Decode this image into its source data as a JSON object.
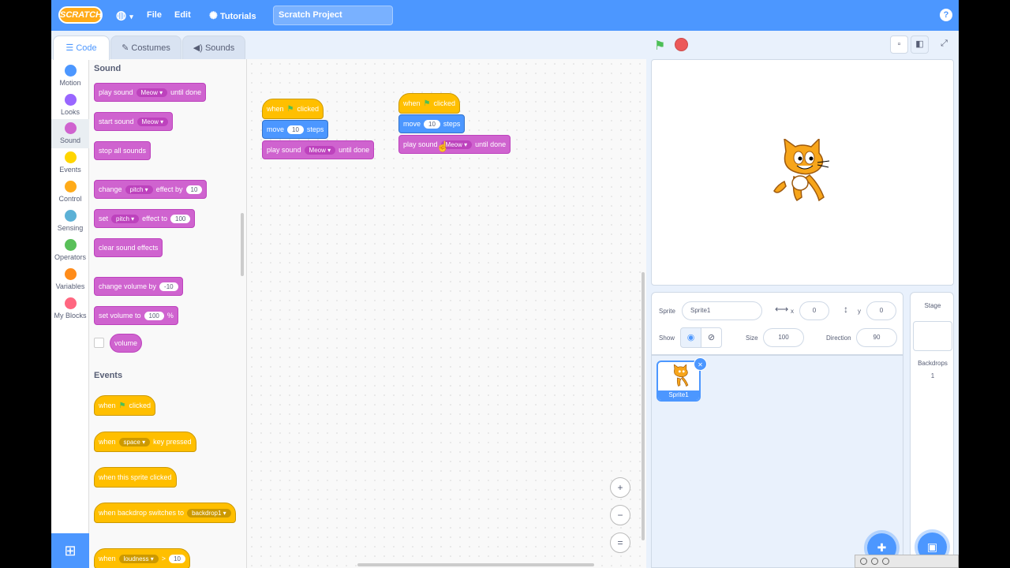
{
  "menubar": {
    "logo": "SCRATCH",
    "globe_icon": "globe-icon",
    "file": "File",
    "edit": "Edit",
    "tutorials": "Tutorials",
    "project_title": "Scratch Project",
    "help": "?"
  },
  "tabs": [
    {
      "label": "Code",
      "icon": "code-icon"
    },
    {
      "label": "Costumes",
      "icon": "brush-icon"
    },
    {
      "label": "Sounds",
      "icon": "speaker-icon"
    }
  ],
  "categories": [
    {
      "label": "Motion",
      "color": "#4c97ff"
    },
    {
      "label": "Looks",
      "color": "#9966ff"
    },
    {
      "label": "Sound",
      "color": "#cf63cf"
    },
    {
      "label": "Events",
      "color": "#ffbf00"
    },
    {
      "label": "Control",
      "color": "#ffab19"
    },
    {
      "label": "Sensing",
      "color": "#5cb1d6"
    },
    {
      "label": "Operators",
      "color": "#59c059"
    },
    {
      "label": "Variables",
      "color": "#ff8c1a"
    },
    {
      "label": "My Blocks",
      "color": "#ff6680"
    }
  ],
  "palette": {
    "sound_heading": "Sound",
    "events_heading": "Events",
    "play_sound": "play sound",
    "until_done": "until done",
    "meow": "Meow",
    "start_sound": "start sound",
    "stop_all_sounds": "stop all sounds",
    "change": "change",
    "pitch": "pitch",
    "effect_by": "effect by",
    "ten": "10",
    "set": "set",
    "effect_to": "effect to",
    "hundred": "100",
    "clear_sound_effects": "clear sound effects",
    "change_volume_by": "change volume by",
    "minus_ten": "-10",
    "set_volume_to": "set volume to",
    "percent": "%",
    "volume": "volume",
    "when": "when",
    "clicked": "clicked",
    "space": "space",
    "key_pressed": "key pressed",
    "when_sprite_clicked": "when this sprite clicked",
    "when_backdrop_switches_to": "when backdrop switches to",
    "backdrop1": "backdrop1",
    "loudness": "loudness",
    "gt": ">"
  },
  "script1": {
    "when": "when",
    "clicked": "clicked",
    "move": "move",
    "steps_value": "10",
    "steps": "steps",
    "play_sound": "play sound",
    "sound_name": "Meow",
    "until_done": "until done"
  },
  "script2": {
    "when": "when",
    "clicked": "clicked",
    "move": "move",
    "steps_value": "10",
    "steps": "steps",
    "play_sound": "play sound",
    "sound_name": "Meow",
    "until_done": "until done"
  },
  "zoom": {
    "zoom_in": "+",
    "zoom_out": "−",
    "reset": "="
  },
  "sprite_info": {
    "sprite_label": "Sprite",
    "sprite_name": "Sprite1",
    "x_label": "x",
    "x_value": "0",
    "y_label": "y",
    "y_value": "0",
    "show_label": "Show",
    "size_label": "Size",
    "size_value": "100",
    "direction_label": "Direction",
    "direction_value": "90"
  },
  "sprites": [
    {
      "name": "Sprite1"
    }
  ],
  "stage_pane": {
    "title": "Stage",
    "backdrops_label": "Backdrops",
    "backdrops_count": "1"
  }
}
